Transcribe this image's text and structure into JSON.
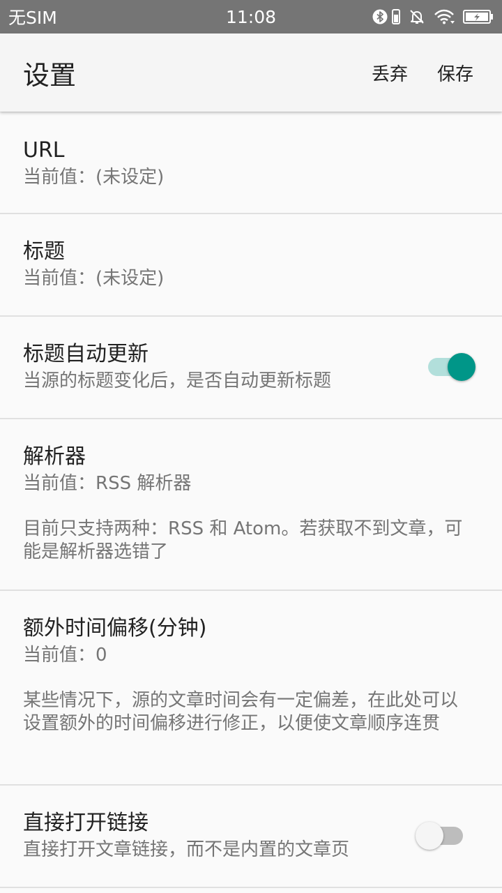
{
  "status_bar": {
    "carrier": "无SIM",
    "time": "11:08"
  },
  "app_bar": {
    "title": "设置",
    "discard_label": "丢弃",
    "save_label": "保存"
  },
  "preferences": [
    {
      "title": "URL",
      "summary": "当前值：(未设定)"
    },
    {
      "title": "标题",
      "summary": "当前值：(未设定)"
    },
    {
      "title": "标题自动更新",
      "summary": "当源的标题变化后，是否自动更新标题",
      "switch_on": true
    },
    {
      "title": "解析器",
      "summary": "当前值：RSS 解析器",
      "description": "目前只支持两种：RSS 和 Atom。若获取不到文章，可能是解析器选错了"
    },
    {
      "title": "额外时间偏移(分钟)",
      "summary": "当前值：0",
      "description": "某些情况下，源的文章时间会有一定偏差，在此处可以设置额外的时间偏移进行修正，以便使文章顺序连贯"
    },
    {
      "title": "直接打开链接",
      "summary": "直接打开文章链接，而不是内置的文章页",
      "switch_on": false
    }
  ],
  "colors": {
    "accent": "#009688",
    "accent_track": "#b2dfdb",
    "status_bar": "#757575",
    "app_bar": "#f5f5f5"
  },
  "icons": [
    "bluetooth-icon",
    "vibrate-icon",
    "notifications-off-icon",
    "wifi-icon",
    "battery-charging-icon"
  ]
}
